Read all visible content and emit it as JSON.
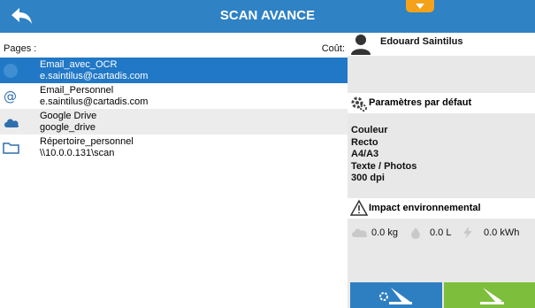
{
  "header": {
    "title": "SCAN AVANCE"
  },
  "list": {
    "pages_label": "Pages :",
    "cost_label": "Coût:",
    "items": [
      {
        "name": "Email_avec_OCR",
        "detail": "e.saintilus@cartadis.com",
        "icon": "email-ocr-icon"
      },
      {
        "name": "Email_Personnel",
        "detail": "e.saintilus@cartadis.com",
        "icon": "at-sign-icon"
      },
      {
        "name": "Google Drive",
        "detail": "google_drive",
        "icon": "cloud-icon"
      },
      {
        "name": "Répertoire_personnel",
        "detail": "\\\\10.0.0.131\\scan",
        "icon": "folder-icon"
      }
    ]
  },
  "user": {
    "name": "Edouard Saintilus"
  },
  "params": {
    "title": "Paramètres par défaut",
    "color": "Couleur",
    "sides": "Recto",
    "format": "A4/A3",
    "mode": "Texte / Photos",
    "resolution": "300 dpi"
  },
  "impact": {
    "title": "Impact environnemental",
    "co2": "0.0 kg",
    "water": "0.0 L",
    "energy": "0.0 kWh"
  },
  "colors": {
    "header": "#2f82c4",
    "selected": "#2178c6",
    "go": "#7dbe3c",
    "dropdown": "#f3a21a"
  }
}
